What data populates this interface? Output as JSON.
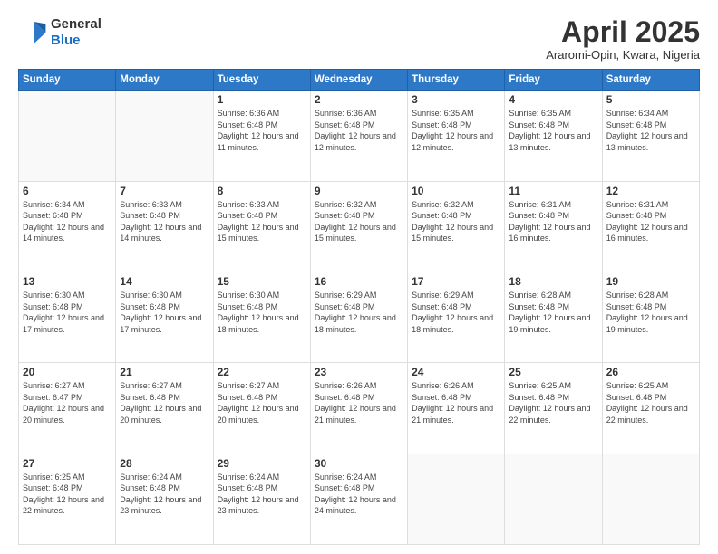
{
  "header": {
    "logo_line1": "General",
    "logo_line2": "Blue",
    "month": "April 2025",
    "location": "Araromi-Opin, Kwara, Nigeria"
  },
  "weekdays": [
    "Sunday",
    "Monday",
    "Tuesday",
    "Wednesday",
    "Thursday",
    "Friday",
    "Saturday"
  ],
  "weeks": [
    [
      {
        "day": "",
        "info": ""
      },
      {
        "day": "",
        "info": ""
      },
      {
        "day": "1",
        "info": "Sunrise: 6:36 AM\nSunset: 6:48 PM\nDaylight: 12 hours and 11 minutes."
      },
      {
        "day": "2",
        "info": "Sunrise: 6:36 AM\nSunset: 6:48 PM\nDaylight: 12 hours and 12 minutes."
      },
      {
        "day": "3",
        "info": "Sunrise: 6:35 AM\nSunset: 6:48 PM\nDaylight: 12 hours and 12 minutes."
      },
      {
        "day": "4",
        "info": "Sunrise: 6:35 AM\nSunset: 6:48 PM\nDaylight: 12 hours and 13 minutes."
      },
      {
        "day": "5",
        "info": "Sunrise: 6:34 AM\nSunset: 6:48 PM\nDaylight: 12 hours and 13 minutes."
      }
    ],
    [
      {
        "day": "6",
        "info": "Sunrise: 6:34 AM\nSunset: 6:48 PM\nDaylight: 12 hours and 14 minutes."
      },
      {
        "day": "7",
        "info": "Sunrise: 6:33 AM\nSunset: 6:48 PM\nDaylight: 12 hours and 14 minutes."
      },
      {
        "day": "8",
        "info": "Sunrise: 6:33 AM\nSunset: 6:48 PM\nDaylight: 12 hours and 15 minutes."
      },
      {
        "day": "9",
        "info": "Sunrise: 6:32 AM\nSunset: 6:48 PM\nDaylight: 12 hours and 15 minutes."
      },
      {
        "day": "10",
        "info": "Sunrise: 6:32 AM\nSunset: 6:48 PM\nDaylight: 12 hours and 15 minutes."
      },
      {
        "day": "11",
        "info": "Sunrise: 6:31 AM\nSunset: 6:48 PM\nDaylight: 12 hours and 16 minutes."
      },
      {
        "day": "12",
        "info": "Sunrise: 6:31 AM\nSunset: 6:48 PM\nDaylight: 12 hours and 16 minutes."
      }
    ],
    [
      {
        "day": "13",
        "info": "Sunrise: 6:30 AM\nSunset: 6:48 PM\nDaylight: 12 hours and 17 minutes."
      },
      {
        "day": "14",
        "info": "Sunrise: 6:30 AM\nSunset: 6:48 PM\nDaylight: 12 hours and 17 minutes."
      },
      {
        "day": "15",
        "info": "Sunrise: 6:30 AM\nSunset: 6:48 PM\nDaylight: 12 hours and 18 minutes."
      },
      {
        "day": "16",
        "info": "Sunrise: 6:29 AM\nSunset: 6:48 PM\nDaylight: 12 hours and 18 minutes."
      },
      {
        "day": "17",
        "info": "Sunrise: 6:29 AM\nSunset: 6:48 PM\nDaylight: 12 hours and 18 minutes."
      },
      {
        "day": "18",
        "info": "Sunrise: 6:28 AM\nSunset: 6:48 PM\nDaylight: 12 hours and 19 minutes."
      },
      {
        "day": "19",
        "info": "Sunrise: 6:28 AM\nSunset: 6:48 PM\nDaylight: 12 hours and 19 minutes."
      }
    ],
    [
      {
        "day": "20",
        "info": "Sunrise: 6:27 AM\nSunset: 6:47 PM\nDaylight: 12 hours and 20 minutes."
      },
      {
        "day": "21",
        "info": "Sunrise: 6:27 AM\nSunset: 6:48 PM\nDaylight: 12 hours and 20 minutes."
      },
      {
        "day": "22",
        "info": "Sunrise: 6:27 AM\nSunset: 6:48 PM\nDaylight: 12 hours and 20 minutes."
      },
      {
        "day": "23",
        "info": "Sunrise: 6:26 AM\nSunset: 6:48 PM\nDaylight: 12 hours and 21 minutes."
      },
      {
        "day": "24",
        "info": "Sunrise: 6:26 AM\nSunset: 6:48 PM\nDaylight: 12 hours and 21 minutes."
      },
      {
        "day": "25",
        "info": "Sunrise: 6:25 AM\nSunset: 6:48 PM\nDaylight: 12 hours and 22 minutes."
      },
      {
        "day": "26",
        "info": "Sunrise: 6:25 AM\nSunset: 6:48 PM\nDaylight: 12 hours and 22 minutes."
      }
    ],
    [
      {
        "day": "27",
        "info": "Sunrise: 6:25 AM\nSunset: 6:48 PM\nDaylight: 12 hours and 22 minutes."
      },
      {
        "day": "28",
        "info": "Sunrise: 6:24 AM\nSunset: 6:48 PM\nDaylight: 12 hours and 23 minutes."
      },
      {
        "day": "29",
        "info": "Sunrise: 6:24 AM\nSunset: 6:48 PM\nDaylight: 12 hours and 23 minutes."
      },
      {
        "day": "30",
        "info": "Sunrise: 6:24 AM\nSunset: 6:48 PM\nDaylight: 12 hours and 24 minutes."
      },
      {
        "day": "",
        "info": ""
      },
      {
        "day": "",
        "info": ""
      },
      {
        "day": "",
        "info": ""
      }
    ]
  ]
}
